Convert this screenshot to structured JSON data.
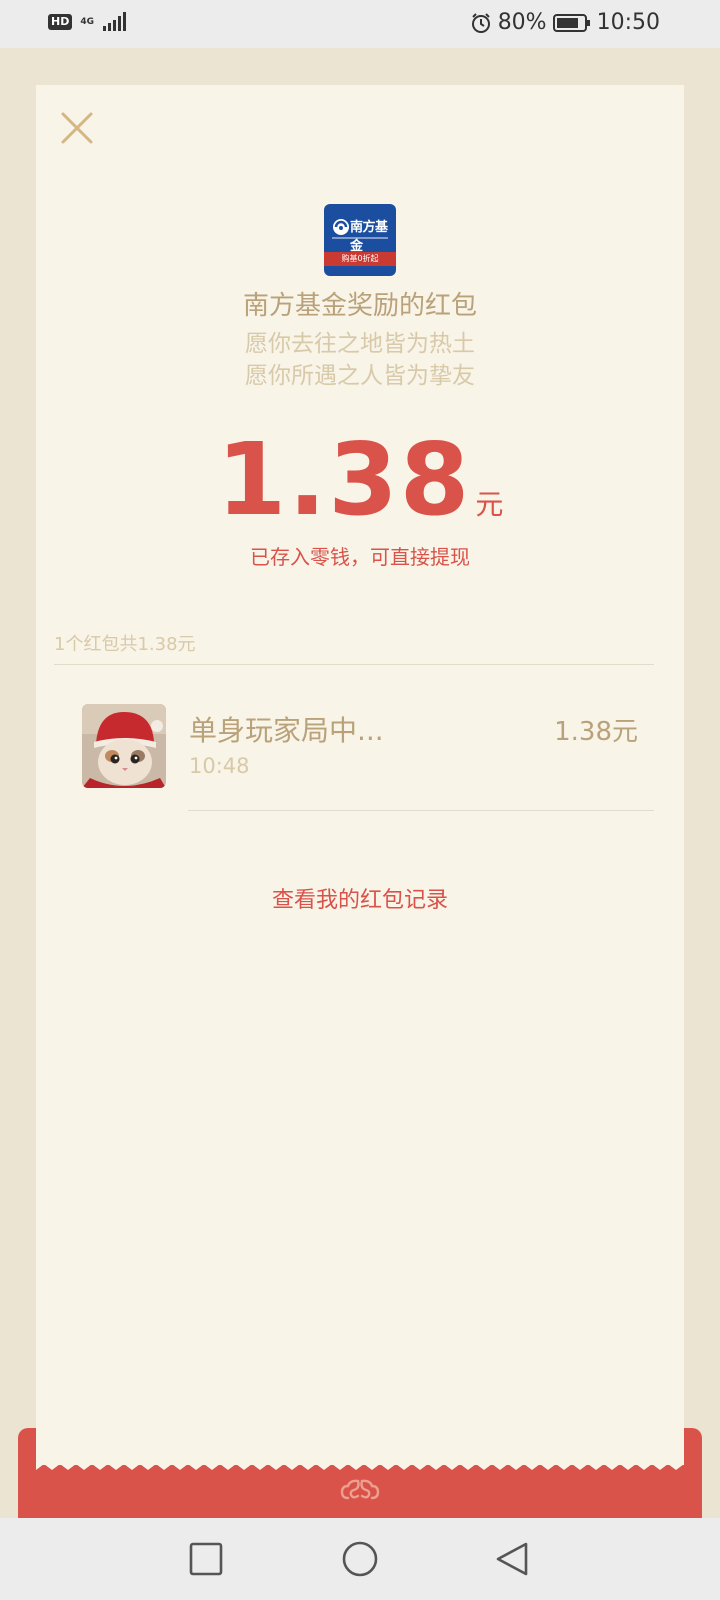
{
  "status_bar": {
    "hd": "HD",
    "network": "4G",
    "battery_percent": "80%",
    "time": "10:50"
  },
  "card": {
    "logo_text": "南方基金",
    "logo_ribbon": "购基0折起",
    "sender_title": "南方基金奖励的红包",
    "blessing_line1": "愿你去往之地皆为热土",
    "blessing_line2": "愿你所遇之人皆为挚友",
    "amount": "1.38",
    "amount_unit": "元",
    "deposit_note": "已存入零钱，可直接提现",
    "summary": "1个红包共1.38元",
    "records": [
      {
        "name": "单身玩家局中...",
        "time": "10:48",
        "amount": "1.38元",
        "avatar_icon": "cat-avatar"
      }
    ],
    "history_link": "查看我的红包记录"
  },
  "icons": {
    "close": "close-icon",
    "footer": "cloud-icon",
    "nav": [
      "recent-apps-icon",
      "home-icon",
      "back-icon"
    ]
  },
  "colors": {
    "accent_red": "#d9534a",
    "gold_text": "#b9a27a",
    "muted_text": "#d8c9a9",
    "card_bg": "#f9f4e8",
    "page_bg": "#ece4d3",
    "logo_blue": "#1c4ea0"
  }
}
